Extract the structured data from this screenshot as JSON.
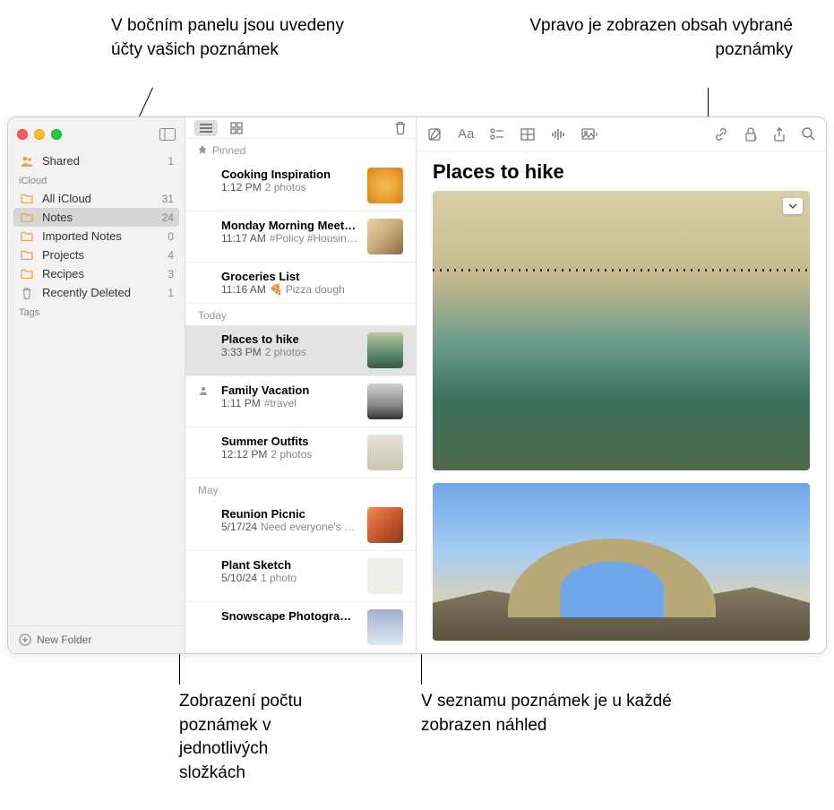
{
  "callouts": {
    "sidebar_accounts": "V bočním panelu jsou uvedeny účty vašich poznámek",
    "note_content": "Vpravo je zobrazen obsah vybrané poznámky",
    "folder_count": "Zobrazení počtu poznámek v jednotlivých složkách",
    "note_preview": "V seznamu poznámek je u každé zobrazen náhled"
  },
  "sidebar": {
    "shared_label": "Shared",
    "shared_count": "1",
    "icloud_header": "iCloud",
    "folders": [
      {
        "label": "All iCloud",
        "count": "31"
      },
      {
        "label": "Notes",
        "count": "24"
      },
      {
        "label": "Imported Notes",
        "count": "0"
      },
      {
        "label": "Projects",
        "count": "4"
      },
      {
        "label": "Recipes",
        "count": "3"
      },
      {
        "label": "Recently Deleted",
        "count": "1"
      }
    ],
    "tags_header": "Tags",
    "new_folder": "New Folder"
  },
  "notelist": {
    "pinned_header": "Pinned",
    "today_header": "Today",
    "may_header": "May",
    "pinned": [
      {
        "title": "Cooking Inspiration",
        "time": "1:12 PM",
        "sub": "2 photos"
      },
      {
        "title": "Monday Morning Meeting",
        "time": "11:17 AM",
        "sub": "#Policy #Housing…"
      },
      {
        "title": "Groceries List",
        "time": "11:16 AM",
        "sub": "Pizza dough"
      }
    ],
    "today": [
      {
        "title": "Places to hike",
        "time": "3:33 PM",
        "sub": "2 photos"
      },
      {
        "title": "Family Vacation",
        "time": "1:11 PM",
        "sub": "#travel"
      },
      {
        "title": "Summer Outfits",
        "time": "12:12 PM",
        "sub": "2 photos"
      }
    ],
    "may": [
      {
        "title": "Reunion Picnic",
        "time": "5/17/24",
        "sub": "Need everyone's u…"
      },
      {
        "title": "Plant Sketch",
        "time": "5/10/24",
        "sub": "1 photo"
      },
      {
        "title": "Snowscape Photography",
        "time": "",
        "sub": ""
      }
    ]
  },
  "content": {
    "title": "Places to hike"
  }
}
